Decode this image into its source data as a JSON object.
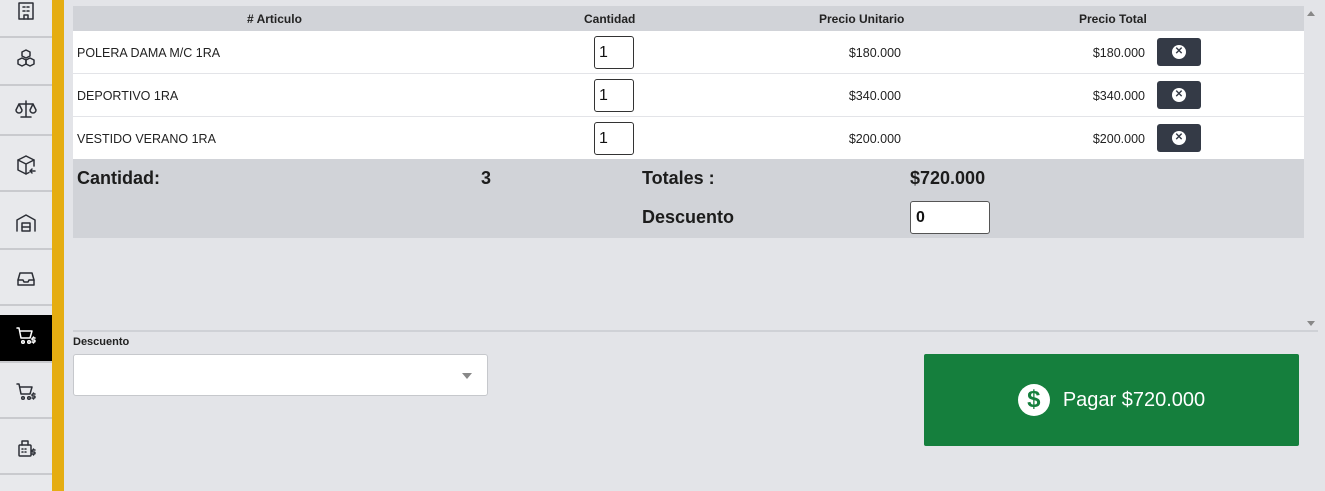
{
  "sidebar": {
    "items": [
      {
        "icon": "building-icon",
        "active": false
      },
      {
        "icon": "boxes-icon",
        "active": false
      },
      {
        "icon": "scale-icon",
        "active": false
      },
      {
        "icon": "box-arrow-icon",
        "active": false
      },
      {
        "icon": "warehouse-icon",
        "active": false
      },
      {
        "icon": "inbox-icon",
        "active": false
      },
      {
        "icon": "cart-dollar-icon",
        "active": true
      },
      {
        "icon": "cart-dollar-icon",
        "active": false
      },
      {
        "icon": "register-dollar-icon",
        "active": false
      }
    ]
  },
  "table": {
    "headers": {
      "articulo": "# Articulo",
      "cantidad": "Cantidad",
      "precio_unitario": "Precio Unitario",
      "precio_total": "Precio Total"
    },
    "rows": [
      {
        "name": "POLERA DAMA M/C 1RA",
        "qty": "1",
        "unit": "$180.000",
        "total": "$180.000"
      },
      {
        "name": "DEPORTIVO 1RA",
        "qty": "1",
        "unit": "$340.000",
        "total": "$340.000"
      },
      {
        "name": "VESTIDO VERANO 1RA",
        "qty": "1",
        "unit": "$200.000",
        "total": "$200.000"
      }
    ]
  },
  "totals": {
    "cantidad_label": "Cantidad:",
    "cantidad_value": "3",
    "totales_label": "Totales :",
    "totales_value": "$720.000",
    "descuento_label": "Descuento",
    "descuento_value": "0"
  },
  "bottom": {
    "descuento_label": "Descuento",
    "descuento_select_value": "",
    "pay_label": "Pagar $720.000"
  },
  "colors": {
    "accent_yellow": "#e5ad12",
    "pay_green": "#157f3d",
    "delete_button": "#343a46"
  }
}
